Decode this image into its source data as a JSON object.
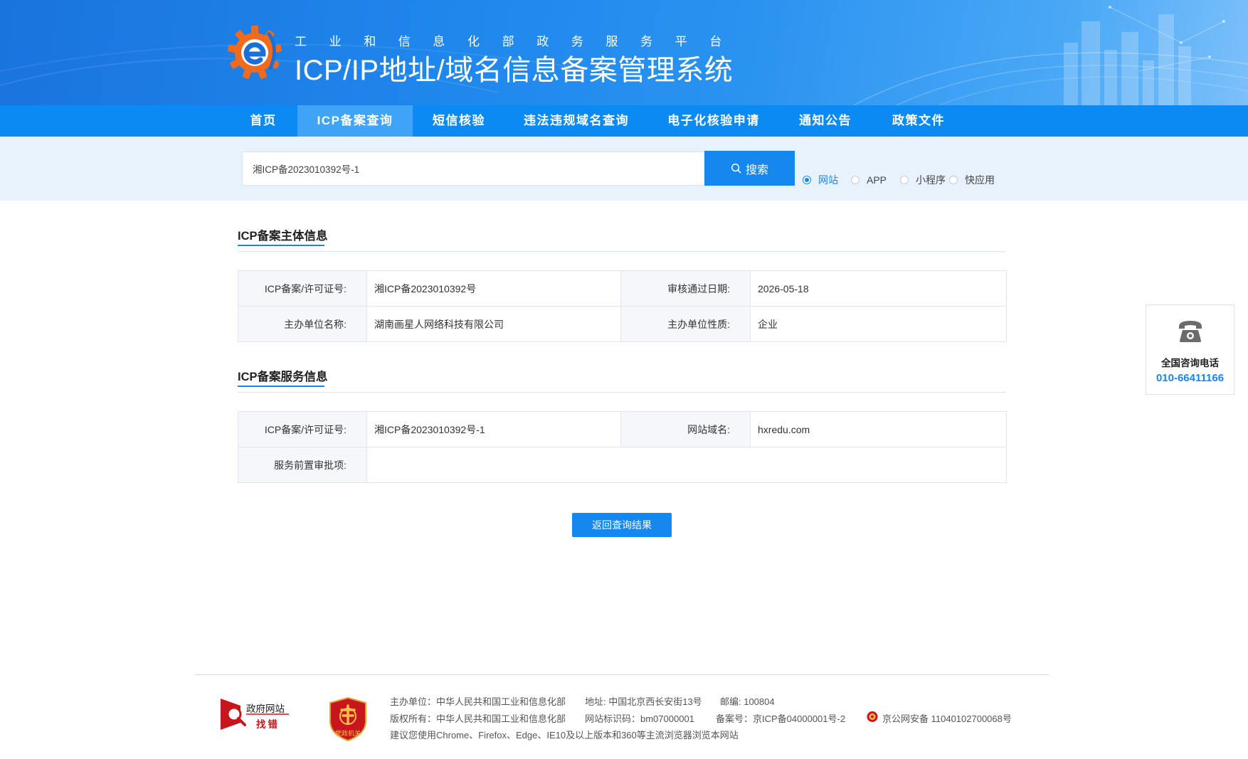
{
  "header": {
    "subtitle": "工业和信息化部政务服务平台",
    "title": "ICP/IP地址/域名信息备案管理系统"
  },
  "nav": {
    "items": [
      {
        "label": "首页"
      },
      {
        "label": "ICP备案查询"
      },
      {
        "label": "短信核验"
      },
      {
        "label": "违法违规域名查询"
      },
      {
        "label": "电子化核验申请"
      },
      {
        "label": "通知公告"
      },
      {
        "label": "政策文件"
      }
    ],
    "active_index": 1
  },
  "search": {
    "value": "湘ICP备2023010392号-1",
    "button_label": "搜索",
    "options": [
      {
        "label": "网站",
        "checked": true
      },
      {
        "label": "APP",
        "checked": false
      },
      {
        "label": "小程序",
        "checked": false
      },
      {
        "label": "快应用",
        "checked": false
      }
    ]
  },
  "subject_info": {
    "title": "ICP备案主体信息",
    "rows": [
      {
        "label1": "ICP备案/许可证号:",
        "value1": "湘ICP备2023010392号",
        "label2": "审核通过日期:",
        "value2": "2026-05-18"
      },
      {
        "label1": "主办单位名称:",
        "value1": "湖南画星人网络科技有限公司",
        "label2": "主办单位性质:",
        "value2": "企业"
      }
    ]
  },
  "service_info": {
    "title": "ICP备案服务信息",
    "rows": [
      {
        "label1": "ICP备案/许可证号:",
        "value1": "湘ICP备2023010392号-1",
        "label2": "网站域名:",
        "value2": "hxredu.com"
      }
    ],
    "pre_approval_label": "服务前置审批项:",
    "pre_approval_value": ""
  },
  "back_button": "返回查询结果",
  "consult": {
    "title": "全国咨询电话",
    "phone": "010-66411166"
  },
  "footer": {
    "gov_badge_top": "政府网站",
    "gov_badge_bottom": "找错",
    "party_badge": "党政机关",
    "line1_sponsor": "主办单位：中华人民共和国工业和信息化部",
    "line1_address": "地址: 中国北京西长安街13号",
    "line1_postcode": "邮编: 100804",
    "line2_copyright": "版权所有：中华人民共和国工业和信息化部",
    "line2_site_id": "网站标识码：bm07000001",
    "line2_icp": "备案号：京ICP备04000001号-2",
    "line2_police": "京公网安备 11040102700068号",
    "line3_browser": "建议您使用Chrome、Firefox、Edge、IE10及以上版本和360等主流浏览器浏览本网站"
  },
  "colors": {
    "primary": "#1587ef",
    "nav_bg": "#0c8af3",
    "nav_active": "#3fa3f7",
    "search_band": "#e8f2fd"
  }
}
